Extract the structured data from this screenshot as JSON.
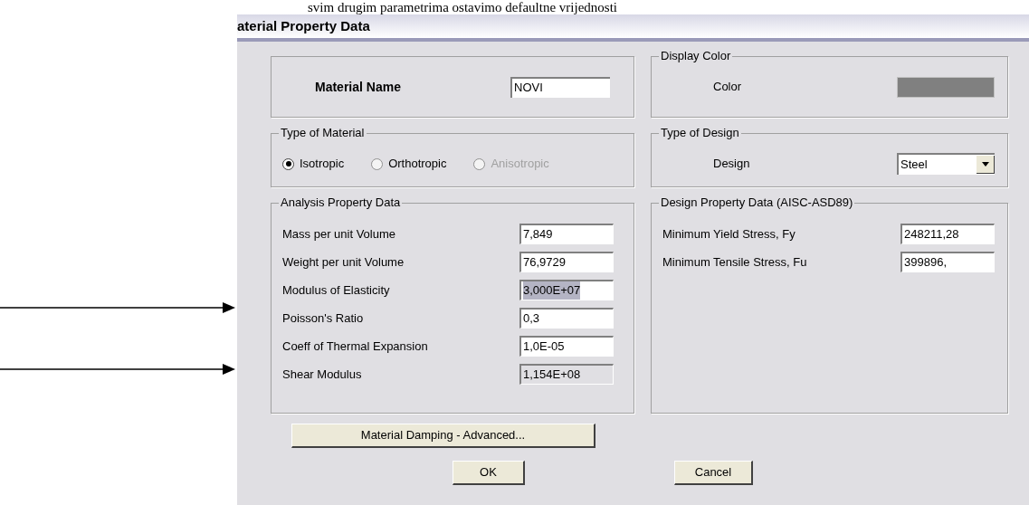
{
  "caption": "svim drugim parametrima ostavimo defaultne vrijednosti",
  "dialog": {
    "title": "aterial Property Data"
  },
  "material_name": {
    "label": "Material Name",
    "value": "NOVI"
  },
  "display_color": {
    "title": "Display Color",
    "label": "Color",
    "color": "#808080"
  },
  "type_of_material": {
    "title": "Type of Material",
    "options": [
      {
        "label": "Isotropic",
        "selected": true,
        "disabled": false
      },
      {
        "label": "Orthotropic",
        "selected": false,
        "disabled": false
      },
      {
        "label": "Anisotropic",
        "selected": false,
        "disabled": true
      }
    ]
  },
  "type_of_design": {
    "title": "Type of Design",
    "label": "Design",
    "value": "Steel"
  },
  "analysis_property_data": {
    "title": "Analysis Property Data",
    "fields": [
      {
        "label": "Mass per unit Volume",
        "value": "7,849",
        "highlighted": false,
        "disabled": false
      },
      {
        "label": "Weight per unit Volume",
        "value": "76,9729",
        "highlighted": false,
        "disabled": false
      },
      {
        "label": "Modulus of Elasticity",
        "value": "3,000E+07",
        "highlighted": true,
        "disabled": false
      },
      {
        "label": "Poisson's Ratio",
        "value": "0,3",
        "highlighted": false,
        "disabled": false
      },
      {
        "label": "Coeff of Thermal Expansion",
        "value": "1,0E-05",
        "highlighted": false,
        "disabled": false
      },
      {
        "label": "Shear Modulus",
        "value": "1,154E+08",
        "highlighted": false,
        "disabled": true
      }
    ]
  },
  "design_property_data": {
    "title": "Design Property Data (AISC-ASD89)",
    "fields": [
      {
        "label": "Minimum Yield Stress, Fy",
        "value": "248211,28",
        "highlighted": false,
        "disabled": false
      },
      {
        "label": "Minimum Tensile Stress, Fu",
        "value": "399896,",
        "highlighted": false,
        "disabled": false
      }
    ]
  },
  "damping_button": "Material Damping - Advanced...",
  "buttons": [
    "OK",
    "Cancel"
  ],
  "arrows": [
    {
      "kind": "arrow"
    },
    {
      "kind": "arrow"
    }
  ]
}
